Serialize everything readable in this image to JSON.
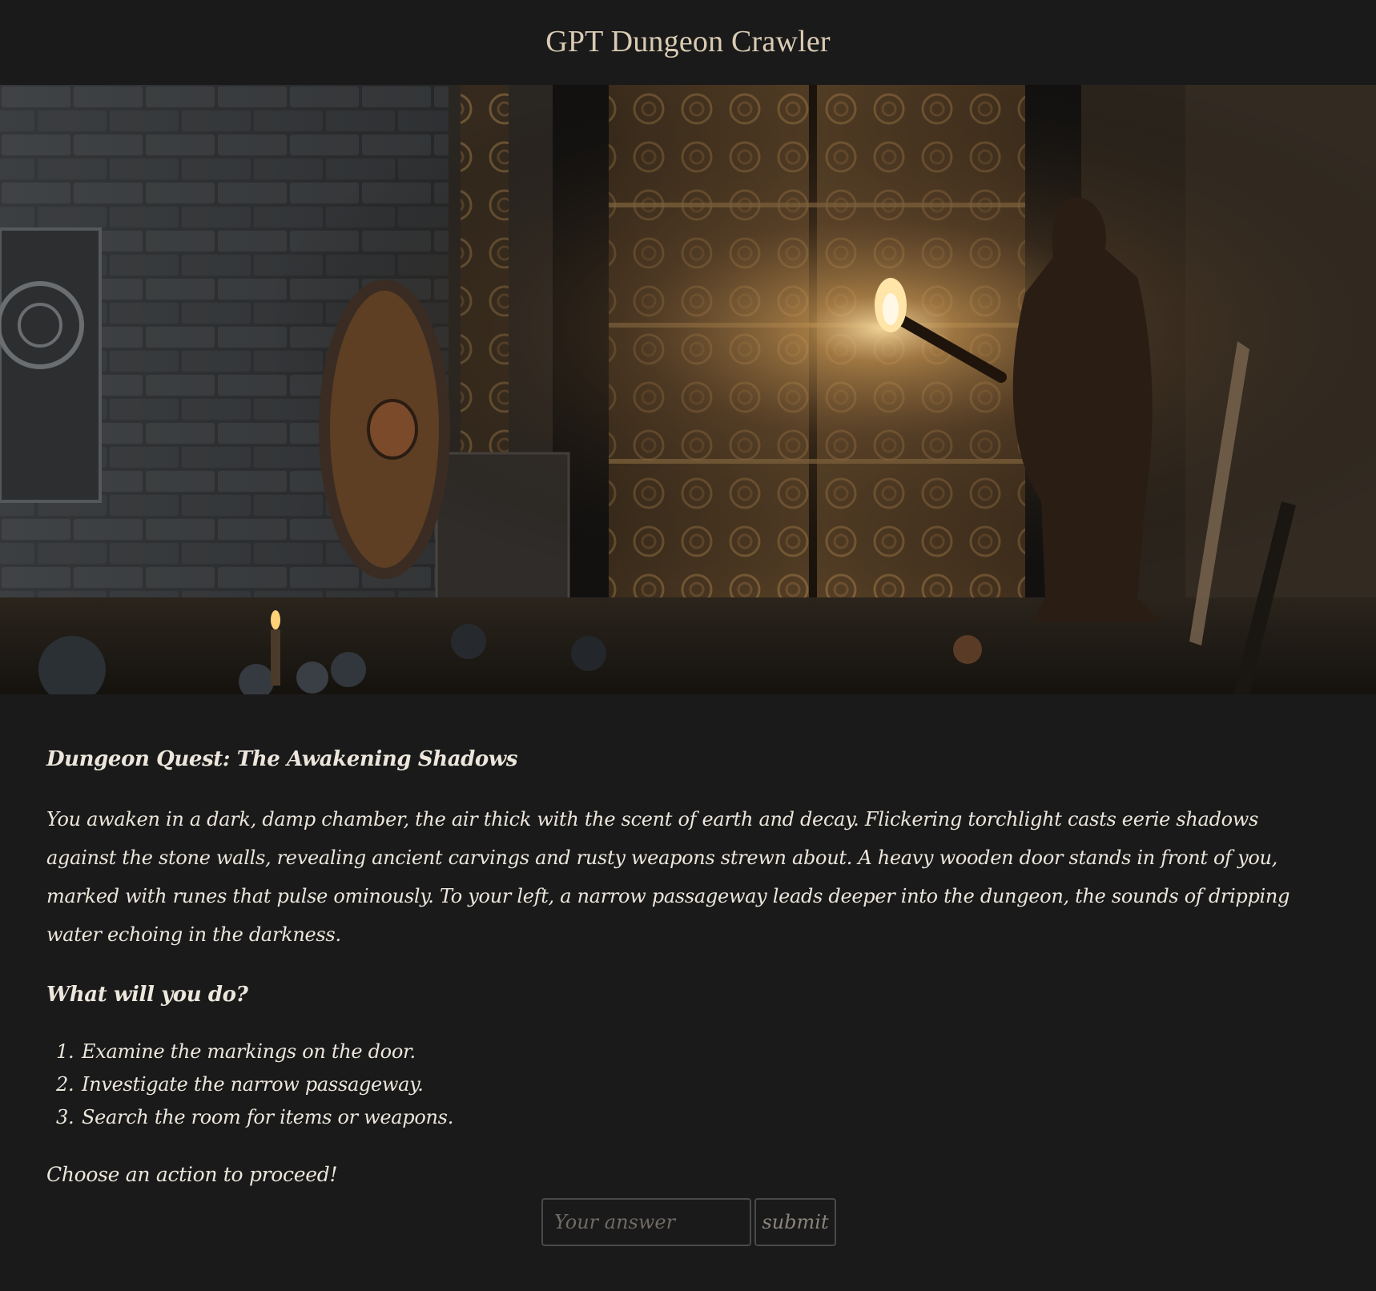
{
  "header": {
    "title": "GPT Dungeon Crawler"
  },
  "scene": {
    "description_icon": "dungeon-scene-illustration",
    "accent_torch": "#ffcf73",
    "accent_wood": "#7a5230"
  },
  "story": {
    "title": "Dungeon Quest: The Awakening Shadows",
    "body": "You awaken in a dark, damp chamber, the air thick with the scent of earth and decay. Flickering torchlight casts eerie shadows against the stone walls, revealing ancient carvings and rusty weapons strewn about. A heavy wooden door stands in front of you, marked with runes that pulse ominously. To your left, a narrow passageway leads deeper into the dungeon, the sounds of dripping water echoing in the darkness.",
    "prompt": "What will you do?",
    "options": [
      {
        "num": "1.",
        "text": "Examine the markings on the door."
      },
      {
        "num": "2.",
        "text": "Investigate the narrow passageway."
      },
      {
        "num": "3.",
        "text": "Search the room for items or weapons."
      }
    ],
    "cta": "Choose an action to proceed!"
  },
  "form": {
    "input_placeholder": "Your answer",
    "input_value": "",
    "submit_label": "submit"
  },
  "colors": {
    "background": "#1a1a1a",
    "title": "#d9cbb3",
    "text": "#ece6dc",
    "border": "#4a4a4a"
  }
}
